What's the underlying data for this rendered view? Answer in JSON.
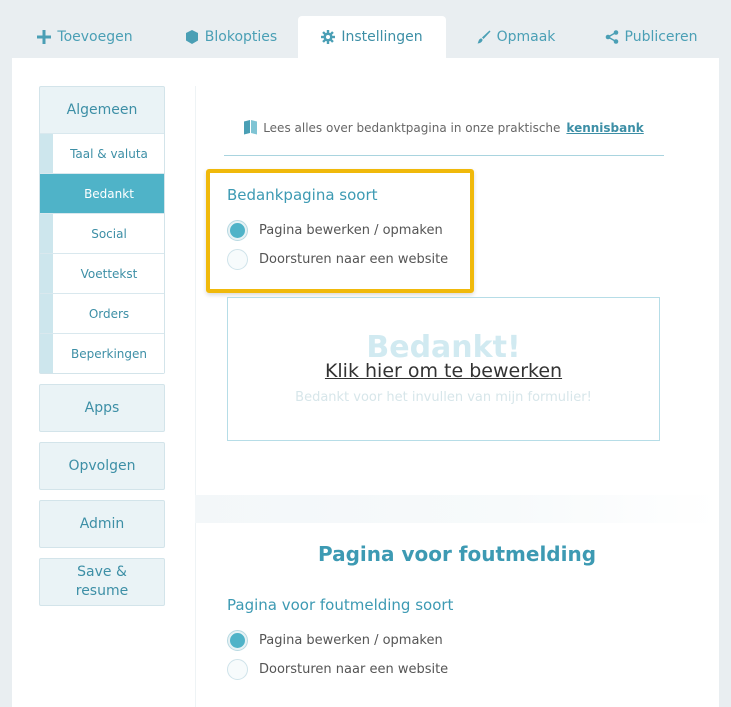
{
  "tabs": [
    {
      "label": "Toevoegen",
      "icon": "plus-icon"
    },
    {
      "label": "Blokopties",
      "icon": "cube-icon"
    },
    {
      "label": "Instellingen",
      "icon": "gear-icon"
    },
    {
      "label": "Opmaak",
      "icon": "brush-icon"
    },
    {
      "label": "Publiceren",
      "icon": "share-icon"
    }
  ],
  "sidebar": {
    "algemeen": "Algemeen",
    "subitems": [
      "Taal & valuta",
      "Bedankt",
      "Social",
      "Voettekst",
      "Orders",
      "Beperkingen"
    ],
    "apps": "Apps",
    "opvolgen": "Opvolgen",
    "admin": "Admin",
    "save_resume": "Save & resume"
  },
  "info": {
    "text": "Lees alles over bedanktpagina in onze praktische",
    "link": "kennisbank",
    "icon": "book-icon"
  },
  "thanks_section": {
    "title": "Bedankpagina soort",
    "options": [
      "Pagina bewerken / opmaken",
      "Doorsturen naar een website"
    ],
    "selected": 0
  },
  "preview": {
    "ghost_title": "Bedankt!",
    "edit_link": "Klik hier om te bewerken",
    "ghost_sub": "Bedankt voor het invullen van mijn formulier!"
  },
  "error_section": {
    "heading": "Pagina voor foutmelding",
    "title": "Pagina voor foutmelding soort",
    "options": [
      "Pagina bewerken / opmaken",
      "Doorsturen naar een website"
    ],
    "selected": 0
  },
  "colors": {
    "accent": "#4fb3c8",
    "highlight": "#f0b90b"
  }
}
